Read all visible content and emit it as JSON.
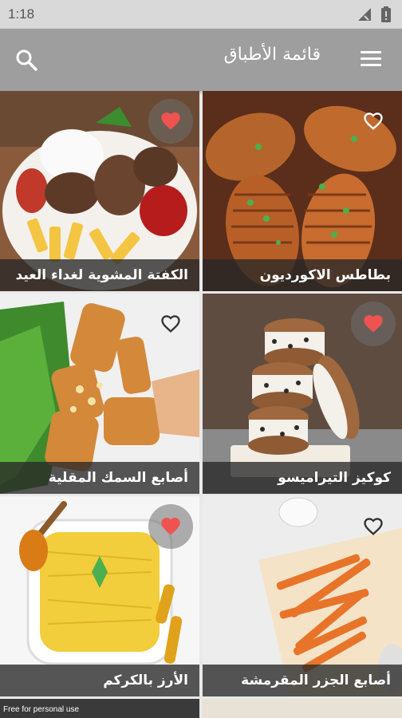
{
  "status": {
    "time": "1:18"
  },
  "appbar": {
    "title": "قائمة الأطباق"
  },
  "dishes": [
    {
      "name": "الكفتة المشوية لغداء العيد",
      "favorite": true
    },
    {
      "name": "بطاطس الاكورديون",
      "favorite": false
    },
    {
      "name": "أصابع السمك المقلية",
      "favorite": false
    },
    {
      "name": "كوكيز التيراميسو",
      "favorite": true
    },
    {
      "name": "الأرز بالكركم",
      "favorite": true
    },
    {
      "name": "أصابع الجزر المقرمشة",
      "favorite": false
    }
  ],
  "watermark": "Free for personal use",
  "colors": {
    "appbar": "#9e9e9e",
    "heart_active": "#ef5350",
    "caption_bg": "#2a2a2a"
  }
}
